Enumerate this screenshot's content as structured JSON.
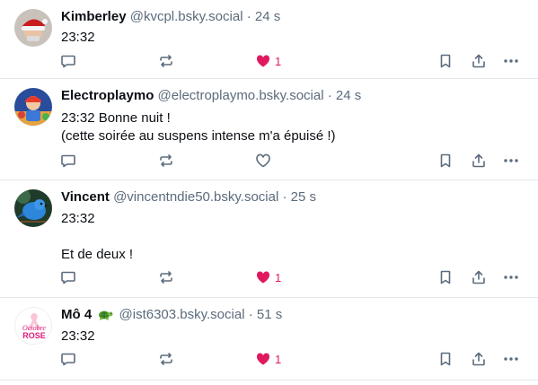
{
  "posts": [
    {
      "name": "Kimberley",
      "handle": "@kvcpl.bsky.social",
      "separator": "·",
      "time": "24 s",
      "text": "23:32",
      "liked": true,
      "like_count": "1",
      "avatar": "santa-hat-avatar"
    },
    {
      "name": "Electroplaymo",
      "handle": "@electroplaymo.bsky.social",
      "separator": "·",
      "time": "24 s",
      "text": "23:32 Bonne nuit !\n(cette soirée au suspens intense m'a épuisé !)",
      "liked": false,
      "like_count": "",
      "avatar": "toy-figure-avatar"
    },
    {
      "name": "Vincent",
      "handle": "@vincentndie50.bsky.social",
      "separator": "·",
      "time": "25 s",
      "text": "23:32\n\nEt de deux !",
      "liked": true,
      "like_count": "1",
      "avatar": "blue-bird-avatar"
    },
    {
      "name": "Mô 4",
      "handle": "@ist6303.bsky.social",
      "separator": "·",
      "time": "51 s",
      "text": "23:32",
      "liked": true,
      "like_count": "1",
      "emoji": "turtle-emoji",
      "avatar": "octobre-rose-avatar",
      "avatar_text_1": "Octobre",
      "avatar_text_2": "ROSE"
    }
  ],
  "colors": {
    "like_active": "#e0195f",
    "icon_gray": "#5b6b7c",
    "divider": "#e4e8ec"
  }
}
